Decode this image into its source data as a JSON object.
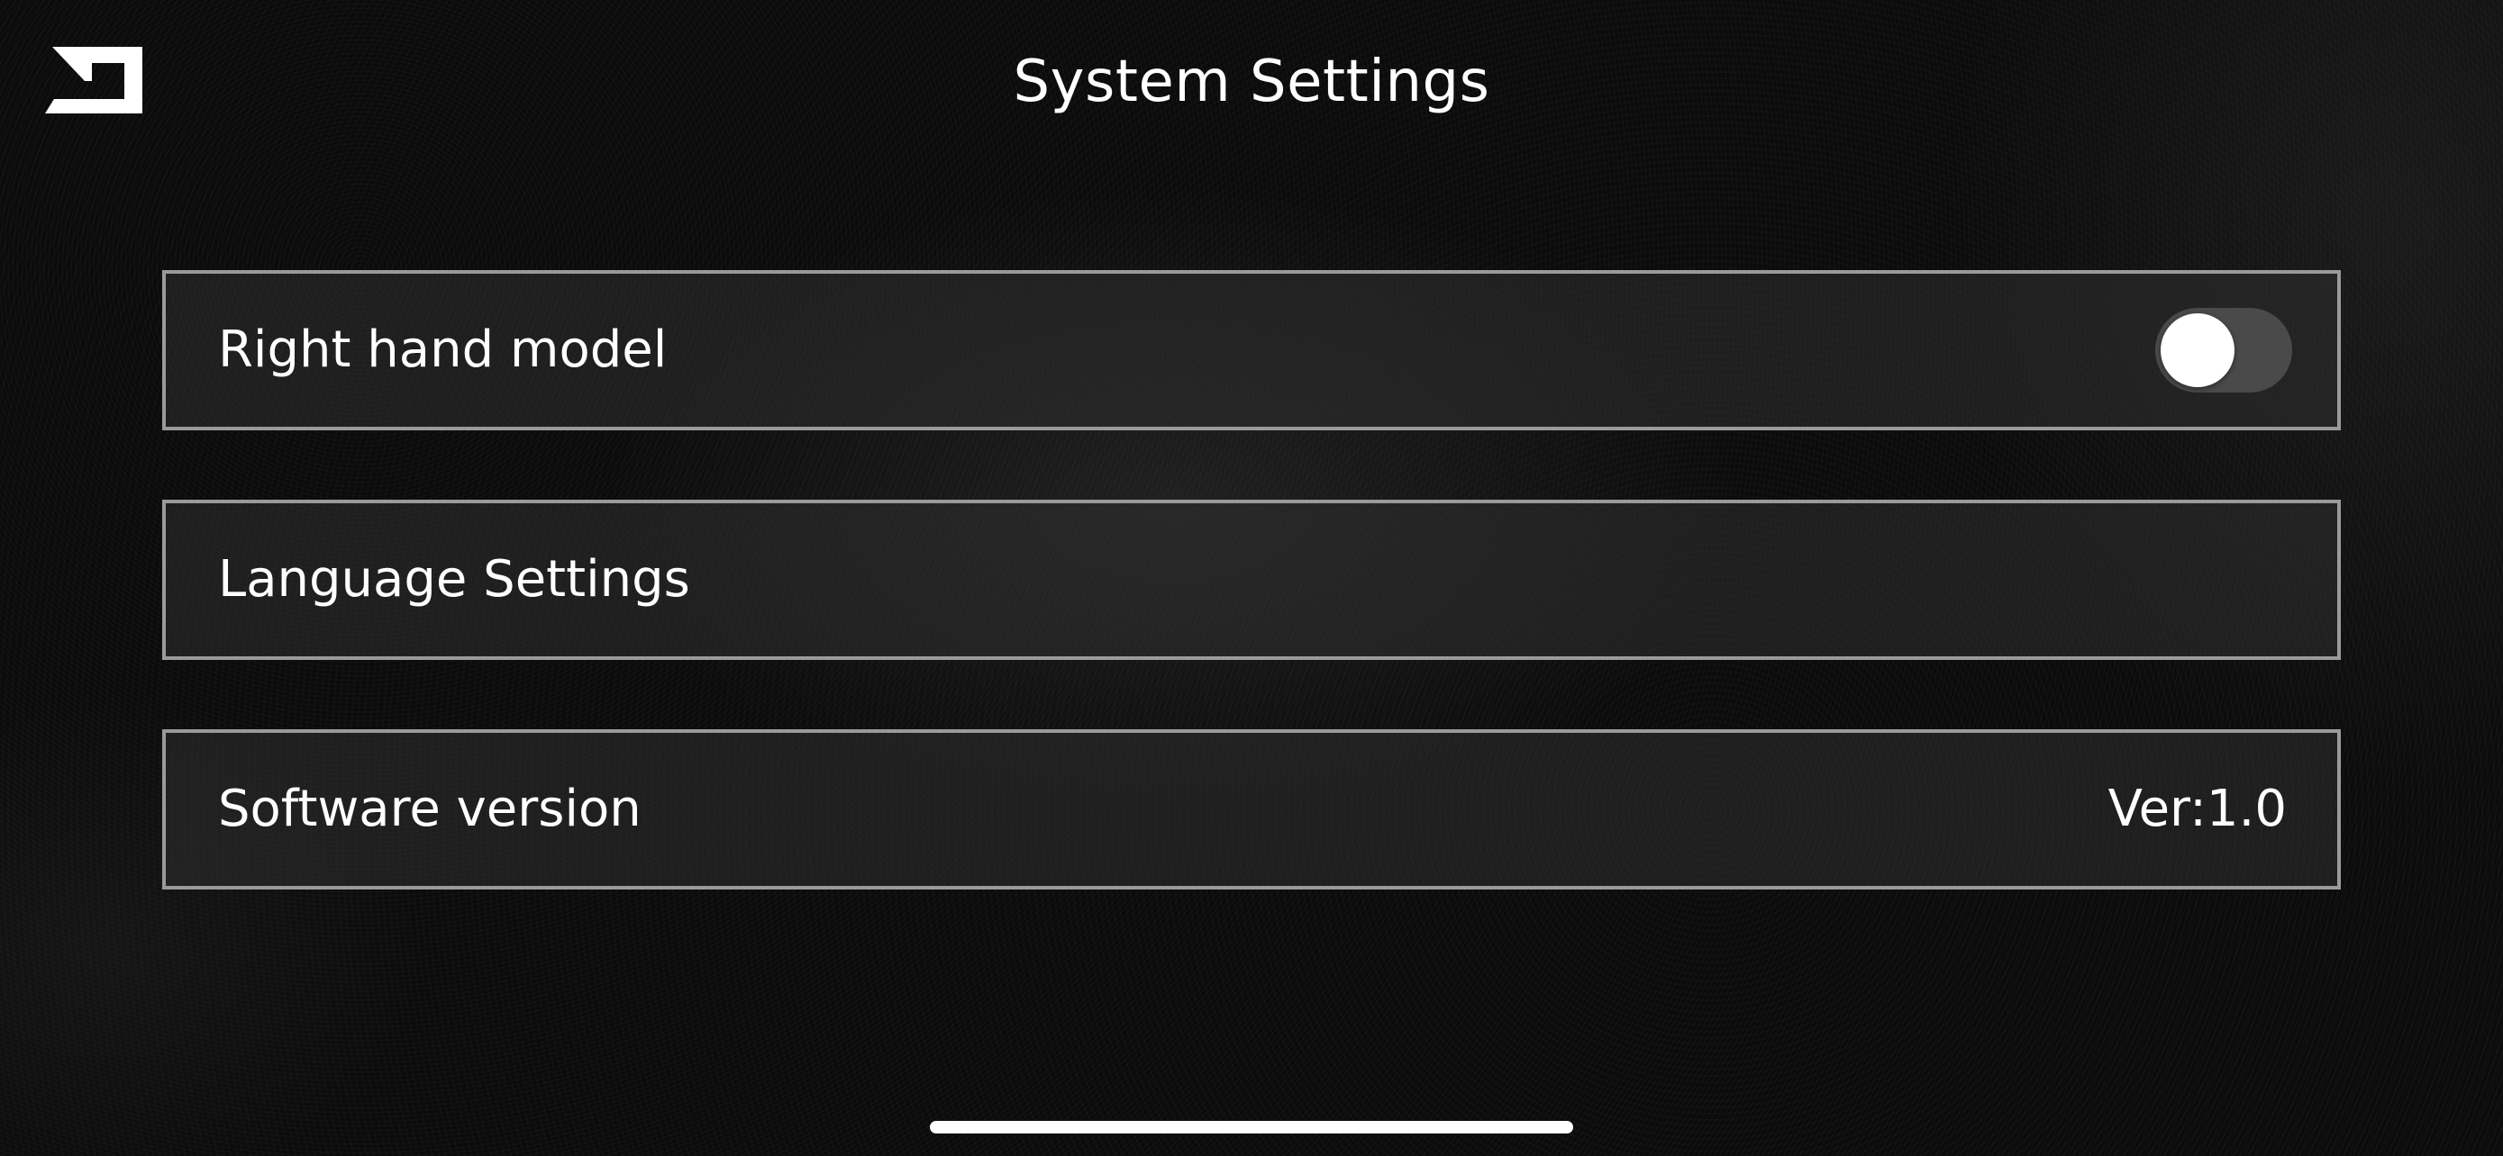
{
  "header": {
    "title": "System Settings",
    "back_icon": "back-return-icon"
  },
  "settings": {
    "right_hand_model": {
      "label": "Right hand model",
      "toggle_on": false
    },
    "language": {
      "label": "Language Settings"
    },
    "software_version": {
      "label": "Software version",
      "value": "Ver:1.0"
    }
  },
  "colors": {
    "background": "#0b0b0b",
    "row_border": "#9a9a9a",
    "text": "#ffffff",
    "toggle_track_off": "#4a4a4a",
    "toggle_knob": "#ffffff"
  }
}
